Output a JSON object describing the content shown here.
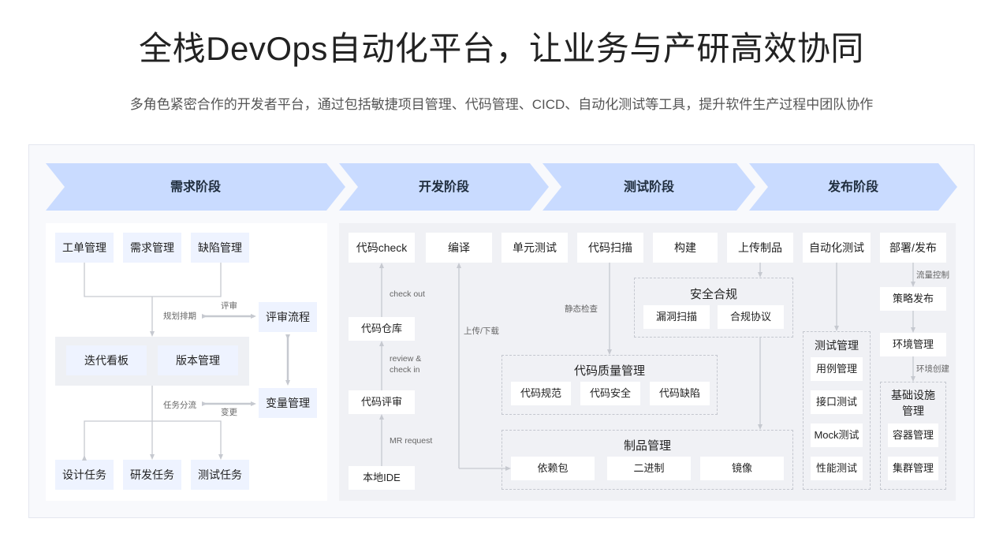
{
  "header": {
    "title": "全栈DevOps自动化平台，让业务与产研高效协同",
    "subtitle": "多角色紧密合作的开发者平台，通过包括敏捷项目管理、代码管理、CICD、自动化测试等工具，提升软件生产过程中团队协作"
  },
  "stages": [
    "需求阶段",
    "开发阶段",
    "测试阶段",
    "发布阶段"
  ],
  "colors": {
    "stage_fill": "#c9dbff",
    "accent_box": "#eef3ff",
    "line": "#c6c9d0"
  },
  "requirements": {
    "top_items": [
      "工单管理",
      "需求管理",
      "缺陷管理"
    ],
    "planning_note": "规划排期",
    "review_note": "评审",
    "review_flow": "评审流程",
    "middle_items": [
      "迭代看板",
      "版本管理"
    ],
    "task_note": "任务分流",
    "change_note": "变更",
    "change_mgmt": "变量管理",
    "bottom_items": [
      "设计任务",
      "研发任务",
      "测试任务"
    ]
  },
  "dev": {
    "top_items": [
      "代码check",
      "编译",
      "单元测试",
      "代码扫描",
      "构建",
      "上传制品"
    ],
    "repo": "代码仓库",
    "review": "代码评审",
    "local_ide": "本地IDE",
    "checkout_note": "check out",
    "review_note": "review &\ncheck in",
    "mr_note": "MR request",
    "upload_note": "上传/下载",
    "static_note": "静态检查",
    "security": {
      "title": "安全合规",
      "items": [
        "漏洞扫描",
        "合规协议"
      ]
    },
    "quality": {
      "title": "代码质量管理",
      "items": [
        "代码规范",
        "代码安全",
        "代码缺陷"
      ]
    },
    "artifact": {
      "title": "制品管理",
      "items": [
        "依赖包",
        "二进制",
        "镜像"
      ]
    }
  },
  "test": {
    "auto_test": "自动化测试",
    "group_title": "测试管理",
    "items": [
      "用例管理",
      "接口测试",
      "Mock测试",
      "性能测试"
    ]
  },
  "release": {
    "deploy": "部署/发布",
    "flow_note": "流量控制",
    "strategy": "策略发布",
    "env": "环境管理",
    "env_note": "环境创建",
    "infra_title": "基础设施\n管理",
    "items": [
      "容器管理",
      "集群管理"
    ]
  }
}
